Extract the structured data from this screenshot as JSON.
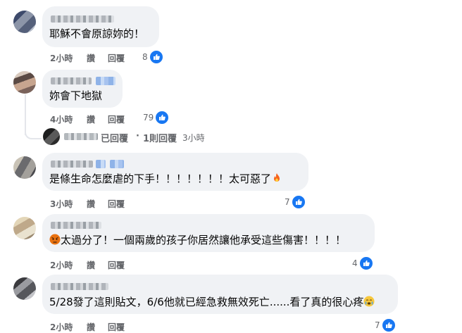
{
  "colors": {
    "like_blue": "#1877f2",
    "bubble": "#f0f2f5",
    "meta_gray": "#65676b"
  },
  "comments": [
    {
      "text": "耶穌不會原諒妳的！",
      "time": "2小時",
      "read": "讚",
      "reply": "回覆",
      "likes": "8"
    },
    {
      "text": "妳會下地獄",
      "time": "4小時",
      "read": "讚",
      "reply": "回覆",
      "likes": "79"
    },
    {
      "text": "是條生命怎麼虐的下手！！！！！！！太可惡了",
      "time": "3小時",
      "read": "讚",
      "reply": "回覆",
      "likes": "7",
      "emoji": "fire-emoji"
    },
    {
      "text": "太過分了！一個兩歲的孩子你居然讓他承受這些傷害！！！！",
      "time": "2小時",
      "read": "讚",
      "reply": "回覆",
      "likes": "4",
      "emoji_prefix": "angry-emoji"
    },
    {
      "text": "5/28發了這則貼文，6/6他就已經急救無效死亡......看了真的很心疼",
      "time": "2小時",
      "read": "讚",
      "reply": "回覆",
      "likes": "7",
      "emoji": "crying-emoji"
    }
  ],
  "reply_summary": {
    "replied": "已回覆",
    "sep": "·",
    "count": "1則回覆",
    "time": "3小時"
  }
}
